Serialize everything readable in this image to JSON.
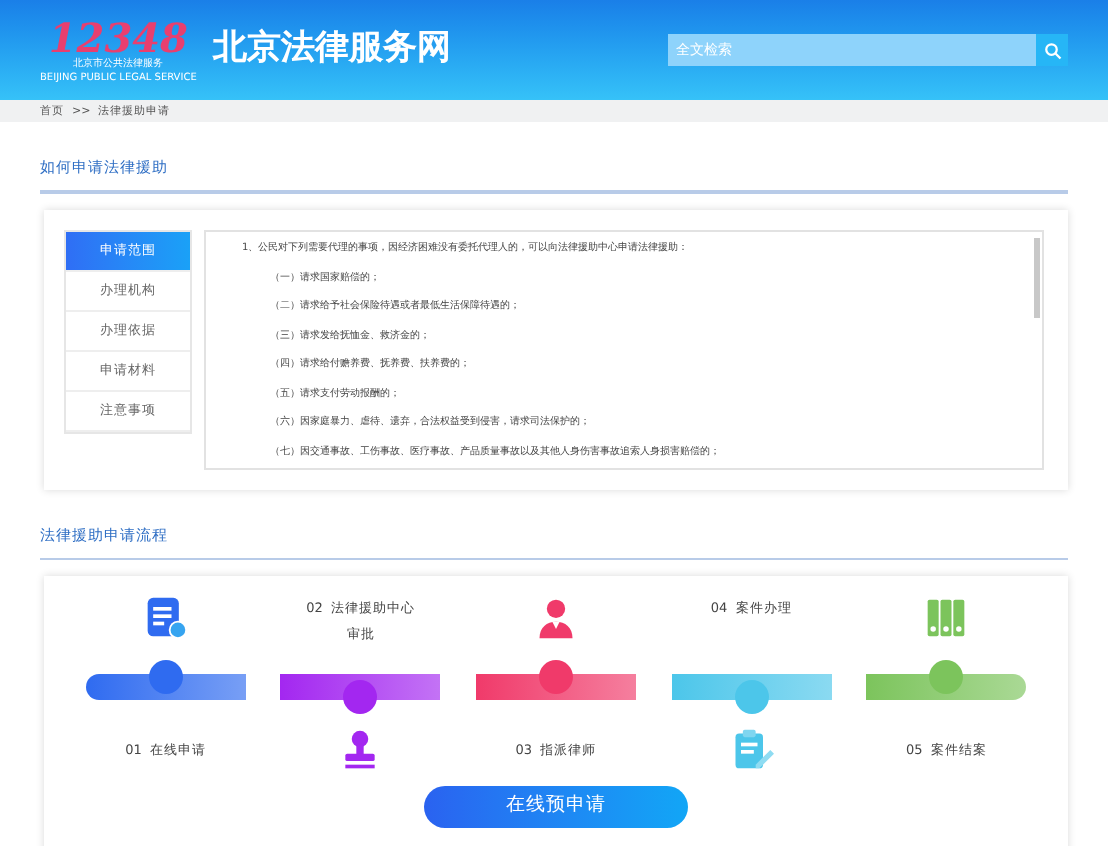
{
  "header": {
    "logo_number": "12348",
    "logo_caption": "北京市公共法律服务",
    "logo_caption_en": "BEIJING PUBLIC LEGAL SERVICE",
    "site_title": "北京法律服务网",
    "search": {
      "placeholder": "全文检索"
    }
  },
  "breadcrumb": [
    "首页",
    ">>",
    "法律援助申请"
  ],
  "guide": {
    "title": "如何申请法律援助",
    "tabs": [
      {
        "label": "申请范围",
        "selected": true
      },
      {
        "label": "办理机构",
        "selected": false
      },
      {
        "label": "办理依据",
        "selected": false
      },
      {
        "label": "申请材料",
        "selected": false
      },
      {
        "label": "注意事项",
        "selected": false
      }
    ],
    "paragraphs": [
      "1、公民对下列需要代理的事项，因经济困难没有委托代理人的，可以向法律援助中心申请法律援助：",
      "（一）请求国家赔偿的；",
      "（二）请求给予社会保险待遇或者最低生活保障待遇的；",
      "（三）请求发给抚恤金、救济金的；",
      "（四）请求给付赡养费、抚养费、扶养费的；",
      "（五）请求支付劳动报酬的；",
      "（六）因家庭暴力、虐待、遗弃，合法权益受到侵害，请求司法保护的；",
      "（七）因交通事故、工伤事故、医疗事故、产品质量事故以及其他人身伤害事故追索人身损害赔偿的；"
    ]
  },
  "process": {
    "title": "法律援助申请流程",
    "steps": [
      {
        "number": "01",
        "label": "在线申请",
        "color": "#2f6bf0"
      },
      {
        "number": "02",
        "label": "法律援助中心审批",
        "color": "#a327f0"
      },
      {
        "number": "03",
        "label": "指派律师",
        "color": "#f03a6a"
      },
      {
        "number": "04",
        "label": "案件办理",
        "color": "#4cc6ea"
      },
      {
        "number": "05",
        "label": "案件结案",
        "color": "#7cc45c"
      }
    ],
    "button": "在线预申请"
  }
}
